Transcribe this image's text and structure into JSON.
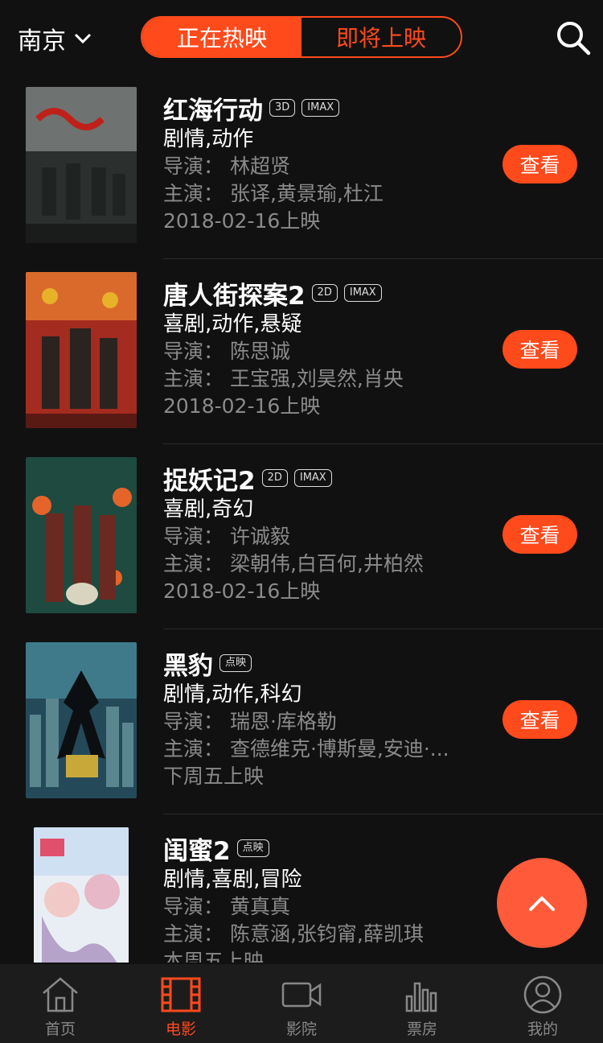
{
  "header": {
    "city": "南京",
    "tabs": [
      {
        "label": "正在热映",
        "active": true
      },
      {
        "label": "即将上映",
        "active": false
      }
    ]
  },
  "movies": [
    {
      "title": "红海行动",
      "tags": [
        "3D",
        "IMAX"
      ],
      "genre": "剧情,动作",
      "director": "导演：  林超贤",
      "actors": "主演：  张译,黄景瑜,杜江",
      "release": "2018-02-16上映",
      "button": "查看"
    },
    {
      "title": "唐人街探案2",
      "tags": [
        "2D",
        "IMAX"
      ],
      "genre": "喜剧,动作,悬疑",
      "director": "导演：  陈思诚",
      "actors": "主演：  王宝强,刘昊然,肖央",
      "release": "2018-02-16上映",
      "button": "查看"
    },
    {
      "title": "捉妖记2",
      "tags": [
        "2D",
        "IMAX"
      ],
      "genre": "喜剧,奇幻",
      "director": "导演：  许诚毅",
      "actors": "主演：  梁朝伟,白百何,井柏然",
      "release": "2018-02-16上映",
      "button": "查看"
    },
    {
      "title": "黑豹",
      "tags": [
        "点映"
      ],
      "genre": "剧情,动作,科幻",
      "director": "导演：  瑞恩·库格勒",
      "actors": "主演：  查德维克·博斯曼,安迪·...",
      "release": "下周五上映",
      "button": "查看"
    },
    {
      "title": "闺蜜2",
      "tags": [
        "点映"
      ],
      "genre": "剧情,喜剧,冒险",
      "director": "导演：  黄真真",
      "actors": "主演：  陈意涵,张钧甯,薛凯琪",
      "release": "本周五上映",
      "button": ""
    }
  ],
  "tabbar": [
    {
      "label": "首页",
      "icon": "home-icon",
      "active": false
    },
    {
      "label": "电影",
      "icon": "film-icon",
      "active": true
    },
    {
      "label": "影院",
      "icon": "camera-icon",
      "active": false
    },
    {
      "label": "票房",
      "icon": "bar-chart-icon",
      "active": false
    },
    {
      "label": "我的",
      "icon": "user-icon",
      "active": false
    }
  ],
  "colors": {
    "accent": "#ff4a1c",
    "background": "#111111",
    "muted": "#8a8a8a"
  }
}
